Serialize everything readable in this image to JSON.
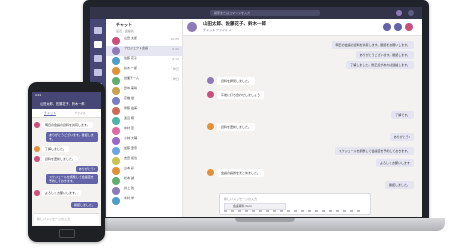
{
  "laptop": {
    "search_placeholder": "検索またはコマンドを入力",
    "chatlist": {
      "title": "チャット",
      "subtitle": "最近 · 連絡先",
      "items": [
        {
          "name": "山田 太郎",
          "time": "10:05",
          "color": "#c94f7c"
        },
        {
          "name": "プロジェクト会議",
          "time": "9:40",
          "color": "#8c7bb6",
          "selected": true
        },
        {
          "name": "佐藤 花子",
          "time": "9:12",
          "color": "#4f9dc9"
        },
        {
          "name": "鈴木 一郎",
          "time": "昨日",
          "color": "#e0913a"
        },
        {
          "name": "営業チーム",
          "time": "昨日",
          "color": "#5fae6e"
        },
        {
          "name": "田中 美咲",
          "time": "",
          "color": "#c9a14f"
        },
        {
          "name": "高橋 健",
          "time": "",
          "color": "#7a7dc4"
        },
        {
          "name": "伊藤 由美",
          "time": "",
          "color": "#d06a5a"
        },
        {
          "name": "渡辺 翔",
          "time": "",
          "color": "#4fb5a8"
        },
        {
          "name": "中村 恵",
          "time": "",
          "color": "#e06aa8"
        },
        {
          "name": "小林 大輔",
          "time": "",
          "color": "#9b6ac9"
        },
        {
          "name": "加藤 里奈",
          "time": "",
          "color": "#6aa8e0"
        },
        {
          "name": "吉田 拓也",
          "time": "",
          "color": "#c9c44f"
        },
        {
          "name": "山本 彩",
          "time": "",
          "color": "#e0913a"
        },
        {
          "name": "松本 誠",
          "time": "",
          "color": "#5fae6e"
        },
        {
          "name": "井上 舞",
          "time": "",
          "color": "#8c7bb6"
        },
        {
          "name": "木村 学",
          "time": "",
          "color": "#4f9dc9"
        }
      ]
    },
    "chat": {
      "title": "山田太郎、佐藤花子、鈴木一郎",
      "tabs": "チャット  ファイル  +",
      "messages": [
        {
          "text": "明日の会議の資料を共有します。確認をお願いします。",
          "mine": true
        },
        {
          "text": "ありがとうございます。確認します。",
          "mine": true
        },
        {
          "text": "了解しました。修正点があれば連絡します。",
          "mine": true
        },
        {
          "text": "資料を拝見しました。",
          "mine": false
        },
        {
          "text": "午後に打ち合わせしましょう",
          "mine": false
        },
        {
          "text": "了解です。",
          "mine": true
        },
        {
          "text": "資料を更新しました。",
          "mine": false
        },
        {
          "text": "ありがとう!",
          "mine": true
        },
        {
          "text": "スケジュールを調整して会議室を予約しておきます。",
          "mine": true
        },
        {
          "text": "よろしくお願いします",
          "mine": true
        },
        {
          "text": "会議の議題をまとめました。",
          "mine": false
        },
        {
          "text": "確認しました。",
          "mine": true
        }
      ],
      "composer_placeholder": "新しいメッセージの入力",
      "attachment_name": "会議資料.docx"
    }
  },
  "phone": {
    "status": "9:41",
    "header_title": "山田太郎、佐藤花子、鈴木一郎",
    "tabs": [
      "チャット",
      "ファイル"
    ],
    "messages": [
      {
        "text": "明日の会議の資料を共有します。",
        "mine": false
      },
      {
        "text": "ありがとうございます。確認します。",
        "mine": true
      },
      {
        "text": "了解しました。",
        "mine": false
      },
      {
        "text": "資料を更新しました。",
        "mine": false
      },
      {
        "text": "ありがとう!",
        "mine": true
      },
      {
        "text": "スケジュールを調整して会議室を予約しておきます。",
        "mine": true
      },
      {
        "text": "よろしくお願いします。",
        "mine": false
      },
      {
        "text": "確認しました。",
        "mine": true
      }
    ],
    "input_placeholder": "新しいメッセージの入力"
  }
}
